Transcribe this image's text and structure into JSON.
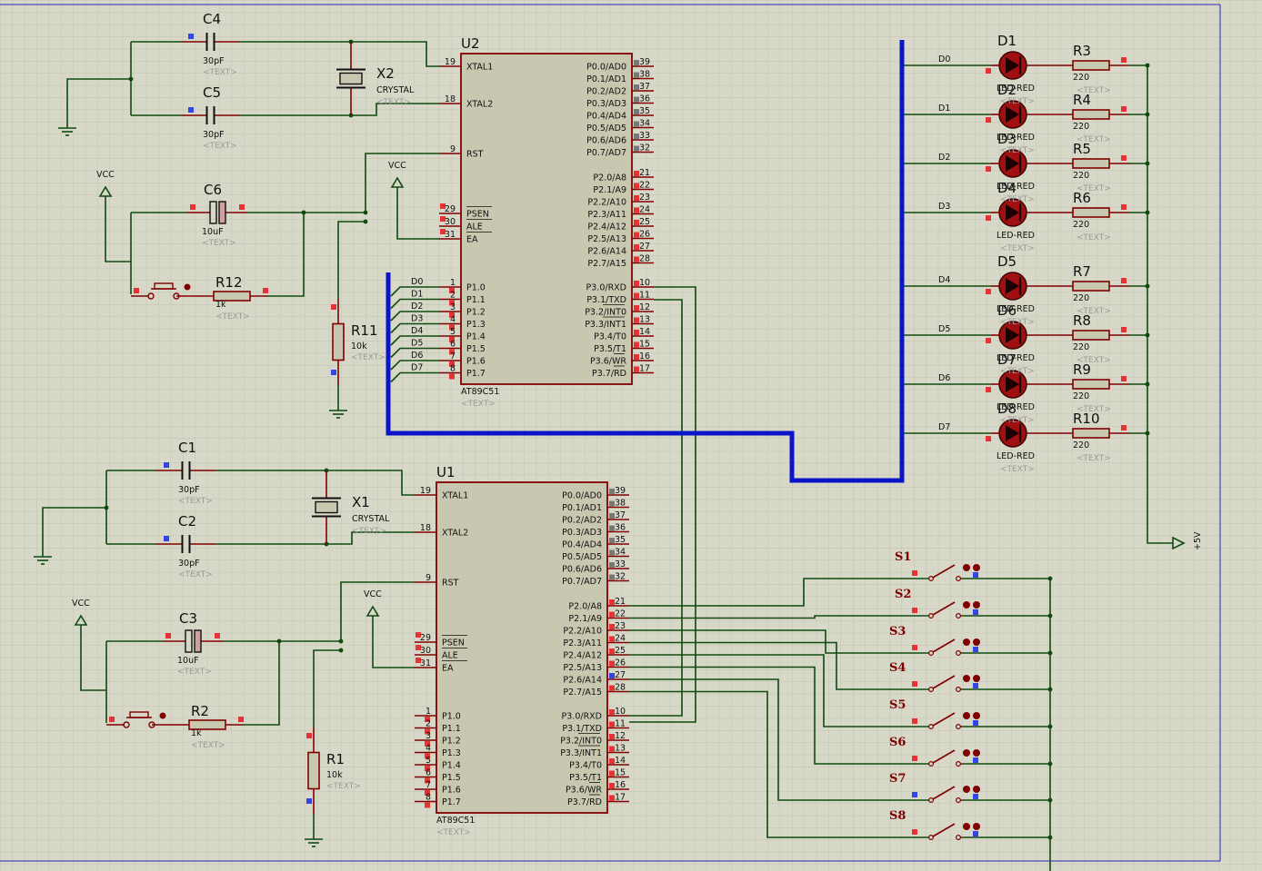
{
  "colors": {
    "background": "#d8d8c8",
    "grid": "#c2c2b4",
    "wire": "#0f4a0f",
    "bus": "#0a14c8",
    "part": "#800000",
    "chip_fill": "#c8c8b0",
    "pin_marker_red": "#e63232",
    "pin_marker_blue": "#3246e6",
    "pin_marker_gray": "#787878",
    "frame": "#2828c0"
  },
  "chips": [
    {
      "ref": "U2",
      "part": "AT89C51",
      "text": "<TEXT>",
      "left_top": [
        {
          "num": "19",
          "name": "XTAL1"
        },
        {
          "num": "18",
          "name": "XTAL2"
        },
        {
          "num": "9",
          "name": "RST"
        },
        {
          "num": "29",
          "name": "PSEN"
        },
        {
          "num": "30",
          "name": "ALE"
        },
        {
          "num": "31",
          "name": "EA"
        }
      ],
      "left_p1": [
        {
          "num": "1",
          "name": "P1.0"
        },
        {
          "num": "2",
          "name": "P1.1"
        },
        {
          "num": "3",
          "name": "P1.2"
        },
        {
          "num": "4",
          "name": "P1.3"
        },
        {
          "num": "5",
          "name": "P1.4"
        },
        {
          "num": "6",
          "name": "P1.5"
        },
        {
          "num": "7",
          "name": "P1.6"
        },
        {
          "num": "8",
          "name": "P1.7"
        }
      ],
      "right_p0": [
        {
          "num": "39",
          "name": "P0.0/AD0"
        },
        {
          "num": "38",
          "name": "P0.1/AD1"
        },
        {
          "num": "37",
          "name": "P0.2/AD2"
        },
        {
          "num": "36",
          "name": "P0.3/AD3"
        },
        {
          "num": "35",
          "name": "P0.4/AD4"
        },
        {
          "num": "34",
          "name": "P0.5/AD5"
        },
        {
          "num": "33",
          "name": "P0.6/AD6"
        },
        {
          "num": "32",
          "name": "P0.7/AD7"
        }
      ],
      "right_p2": [
        {
          "num": "21",
          "name": "P2.0/A8"
        },
        {
          "num": "22",
          "name": "P2.1/A9"
        },
        {
          "num": "23",
          "name": "P2.2/A10"
        },
        {
          "num": "24",
          "name": "P2.3/A11"
        },
        {
          "num": "25",
          "name": "P2.4/A12"
        },
        {
          "num": "26",
          "name": "P2.5/A13"
        },
        {
          "num": "27",
          "name": "P2.6/A14"
        },
        {
          "num": "28",
          "name": "P2.7/A15"
        }
      ],
      "right_p3": [
        {
          "num": "10",
          "name": "P3.0/RXD"
        },
        {
          "num": "11",
          "name": "P3.1/TXD"
        },
        {
          "num": "12",
          "name": "P3.2/INT0"
        },
        {
          "num": "13",
          "name": "P3.3/INT1"
        },
        {
          "num": "14",
          "name": "P3.4/T0"
        },
        {
          "num": "15",
          "name": "P3.5/T1"
        },
        {
          "num": "16",
          "name": "P3.6/WR"
        },
        {
          "num": "17",
          "name": "P3.7/RD"
        }
      ],
      "p1_nets": [
        "D0",
        "D1",
        "D2",
        "D3",
        "D4",
        "D5",
        "D6",
        "D7"
      ]
    },
    {
      "ref": "U1",
      "part": "AT89C51",
      "text": "<TEXT>",
      "left_top": [
        {
          "num": "19",
          "name": "XTAL1"
        },
        {
          "num": "18",
          "name": "XTAL2"
        },
        {
          "num": "9",
          "name": "RST"
        },
        {
          "num": "29",
          "name": "PSEN"
        },
        {
          "num": "30",
          "name": "ALE"
        },
        {
          "num": "31",
          "name": "EA"
        }
      ],
      "left_p1": [
        {
          "num": "1",
          "name": "P1.0"
        },
        {
          "num": "2",
          "name": "P1.1"
        },
        {
          "num": "3",
          "name": "P1.2"
        },
        {
          "num": "4",
          "name": "P1.3"
        },
        {
          "num": "5",
          "name": "P1.4"
        },
        {
          "num": "6",
          "name": "P1.5"
        },
        {
          "num": "7",
          "name": "P1.6"
        },
        {
          "num": "8",
          "name": "P1.7"
        }
      ],
      "right_p0": [
        {
          "num": "39",
          "name": "P0.0/AD0"
        },
        {
          "num": "38",
          "name": "P0.1/AD1"
        },
        {
          "num": "37",
          "name": "P0.2/AD2"
        },
        {
          "num": "36",
          "name": "P0.3/AD3"
        },
        {
          "num": "35",
          "name": "P0.4/AD4"
        },
        {
          "num": "34",
          "name": "P0.5/AD5"
        },
        {
          "num": "33",
          "name": "P0.6/AD6"
        },
        {
          "num": "32",
          "name": "P0.7/AD7"
        }
      ],
      "right_p2": [
        {
          "num": "21",
          "name": "P2.0/A8"
        },
        {
          "num": "22",
          "name": "P2.1/A9"
        },
        {
          "num": "23",
          "name": "P2.2/A10"
        },
        {
          "num": "24",
          "name": "P2.3/A11"
        },
        {
          "num": "25",
          "name": "P2.4/A12"
        },
        {
          "num": "26",
          "name": "P2.5/A13"
        },
        {
          "num": "27",
          "name": "P2.6/A14"
        },
        {
          "num": "28",
          "name": "P2.7/A15"
        }
      ],
      "right_p3": [
        {
          "num": "10",
          "name": "P3.0/RXD"
        },
        {
          "num": "11",
          "name": "P3.1/TXD"
        },
        {
          "num": "12",
          "name": "P3.2/INT0"
        },
        {
          "num": "13",
          "name": "P3.3/INT1"
        },
        {
          "num": "14",
          "name": "P3.4/T0"
        },
        {
          "num": "15",
          "name": "P3.5/T1"
        },
        {
          "num": "16",
          "name": "P3.6/WR"
        },
        {
          "num": "17",
          "name": "P3.7/RD"
        }
      ],
      "p1_nets": []
    }
  ],
  "oscillators": [
    {
      "cap_a": {
        "ref": "C4",
        "value": "30pF",
        "text": "<TEXT>"
      },
      "cap_b": {
        "ref": "C5",
        "value": "30pF",
        "text": "<TEXT>"
      },
      "crystal": {
        "ref": "X2",
        "value": "CRYSTAL",
        "text": "<TEXT>"
      }
    },
    {
      "cap_a": {
        "ref": "C1",
        "value": "30pF",
        "text": "<TEXT>"
      },
      "cap_b": {
        "ref": "C2",
        "value": "30pF",
        "text": "<TEXT>"
      },
      "crystal": {
        "ref": "X1",
        "value": "CRYSTAL",
        "text": "<TEXT>"
      }
    }
  ],
  "resets": [
    {
      "cap": {
        "ref": "C6",
        "value": "10uF",
        "text": "<TEXT>"
      },
      "res": {
        "ref": "R12",
        "value": "1k",
        "text": "<TEXT>"
      },
      "pull": {
        "ref": "R11",
        "value": "10k",
        "text": "<TEXT>"
      },
      "vcc_label": "VCC",
      "ea_vcc_label": "VCC"
    },
    {
      "cap": {
        "ref": "C3",
        "value": "10uF",
        "text": "<TEXT>"
      },
      "res": {
        "ref": "R2",
        "value": "1k",
        "text": "<TEXT>"
      },
      "pull": {
        "ref": "R1",
        "value": "10k",
        "text": "<TEXT>"
      },
      "vcc_label": "VCC",
      "ea_vcc_label": "VCC"
    }
  ],
  "leds": [
    {
      "ref": "D1",
      "value": "LED-RED",
      "net": "D0",
      "res": "R3",
      "res_value": "220",
      "text": "<TEXT>"
    },
    {
      "ref": "D2",
      "value": "LED-RED",
      "net": "D1",
      "res": "R4",
      "res_value": "220",
      "text": "<TEXT>"
    },
    {
      "ref": "D3",
      "value": "LED-RED",
      "net": "D2",
      "res": "R5",
      "res_value": "220",
      "text": "<TEXT>"
    },
    {
      "ref": "D4",
      "value": "LED-RED",
      "net": "D3",
      "res": "R6",
      "res_value": "220",
      "text": "<TEXT>"
    },
    {
      "ref": "D5",
      "value": "LED-RED",
      "net": "D4",
      "res": "R7",
      "res_value": "220",
      "text": "<TEXT>"
    },
    {
      "ref": "D6",
      "value": "LED-RED",
      "net": "D5",
      "res": "R8",
      "res_value": "220",
      "text": "<TEXT>"
    },
    {
      "ref": "D7",
      "value": "LED-RED",
      "net": "D6",
      "res": "R9",
      "res_value": "220",
      "text": "<TEXT>"
    },
    {
      "ref": "D8",
      "value": "LED-RED",
      "net": "D7",
      "res": "R10",
      "res_value": "220",
      "text": "<TEXT>"
    }
  ],
  "supply_label": "+5V",
  "switches": [
    "S1",
    "S2",
    "S3",
    "S4",
    "S5",
    "S6",
    "S7",
    "S8"
  ]
}
